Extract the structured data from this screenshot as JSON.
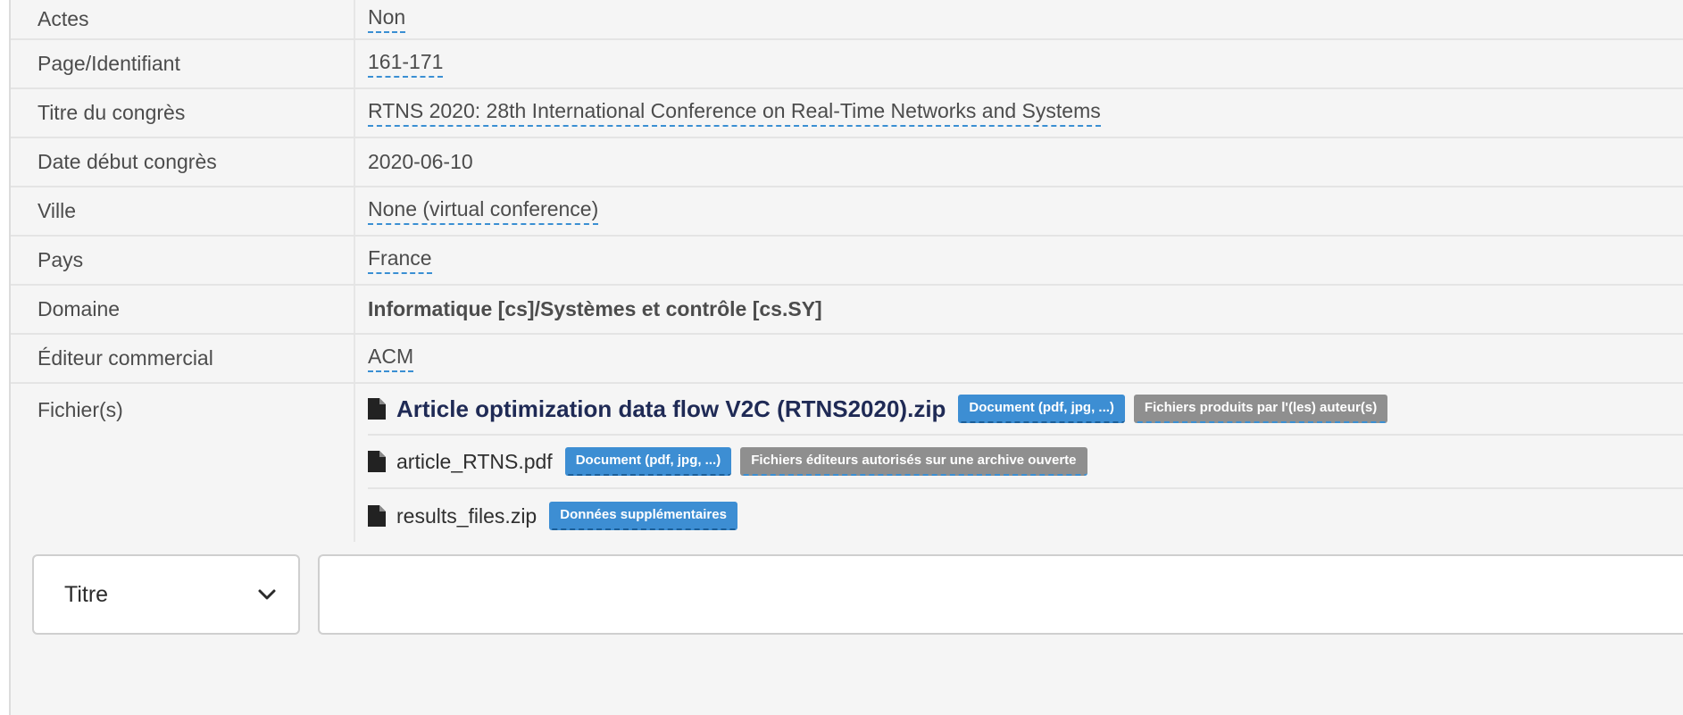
{
  "metadata": {
    "rows": [
      {
        "label": "Actes",
        "value": "Non",
        "style": "link"
      },
      {
        "label": "Page/Identifiant",
        "value": "161-171",
        "style": "link"
      },
      {
        "label": "Titre du congrès",
        "value": "RTNS 2020: 28th International Conference on Real-Time Networks and Systems",
        "style": "link"
      },
      {
        "label": "Date début congrès",
        "value": "2020-06-10",
        "style": "plain"
      },
      {
        "label": "Ville",
        "value": "None (virtual conference)",
        "style": "link"
      },
      {
        "label": "Pays",
        "value": "France",
        "style": "link"
      },
      {
        "label": "Domaine",
        "value": "Informatique [cs]/Systèmes et contrôle [cs.SY]",
        "style": "bold"
      },
      {
        "label": "Éditeur commercial",
        "value": "ACM",
        "style": "link"
      }
    ],
    "files": {
      "label": "Fichier(s)",
      "items": [
        {
          "icon": "file-icon",
          "name": "Article optimization data flow V2C (RTNS2020).zip",
          "badges": [
            "Document (pdf, jpg, ...)",
            "Fichiers produits par l'(les) auteur(s)"
          ]
        },
        {
          "icon": "file-icon",
          "name": "article_RTNS.pdf",
          "badges": [
            "Document (pdf, jpg, ...)",
            "Fichiers éditeurs autorisés sur une archive ouverte"
          ]
        },
        {
          "icon": "file-icon",
          "name": "results_files.zip",
          "badges": [
            "Données supplémentaires"
          ]
        }
      ]
    }
  },
  "search": {
    "field_select": {
      "value": "Titre",
      "icon": "chevron-down-icon"
    },
    "query_input": {
      "value": ""
    }
  },
  "colors": {
    "link_underline": "#3a8fd3",
    "badge_blue": "#3d8ed3",
    "badge_gray": "#8f8f8f",
    "row_background": "#f5f5f5",
    "header_artifact": "#1f2d8f"
  }
}
